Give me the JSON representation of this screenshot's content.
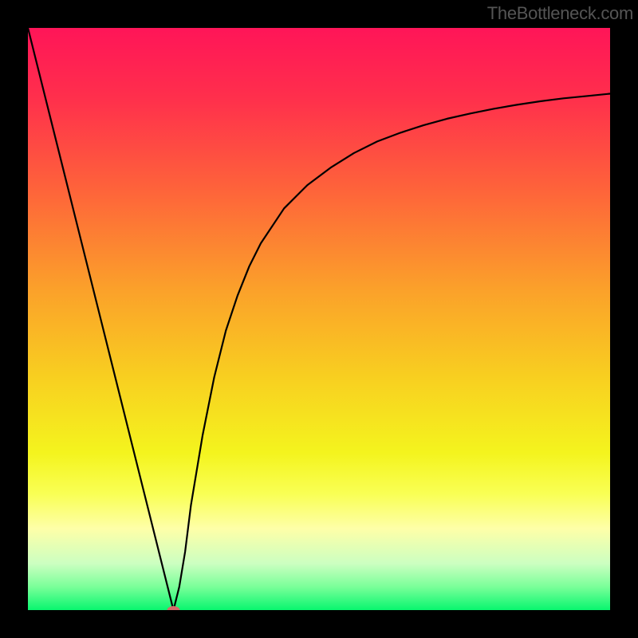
{
  "watermark": "TheBottleneck.com",
  "chart_data": {
    "type": "line",
    "title": "",
    "xlabel": "",
    "ylabel": "",
    "xlim": [
      0,
      100
    ],
    "ylim": [
      0,
      100
    ],
    "background": {
      "kind": "vertical-gradient",
      "stops": [
        {
          "pos": 0.0,
          "color": "#ff1558"
        },
        {
          "pos": 0.12,
          "color": "#ff2f4c"
        },
        {
          "pos": 0.28,
          "color": "#fe643a"
        },
        {
          "pos": 0.45,
          "color": "#fba12a"
        },
        {
          "pos": 0.6,
          "color": "#f8cf20"
        },
        {
          "pos": 0.73,
          "color": "#f4f41e"
        },
        {
          "pos": 0.8,
          "color": "#f9ff54"
        },
        {
          "pos": 0.86,
          "color": "#feffa8"
        },
        {
          "pos": 0.92,
          "color": "#ccffc1"
        },
        {
          "pos": 0.96,
          "color": "#7aff99"
        },
        {
          "pos": 1.0,
          "color": "#08f66f"
        }
      ]
    },
    "series": [
      {
        "name": "bottleneck-curve",
        "color": "#000000",
        "x": [
          0,
          2,
          4,
          6,
          8,
          10,
          12,
          14,
          16,
          18,
          20,
          22,
          24,
          25,
          26,
          27,
          28,
          30,
          32,
          34,
          36,
          38,
          40,
          44,
          48,
          52,
          56,
          60,
          64,
          68,
          72,
          76,
          80,
          84,
          88,
          92,
          96,
          100
        ],
        "y": [
          100,
          92,
          84,
          76,
          68,
          60,
          52,
          44,
          36,
          28,
          20,
          12,
          4,
          0,
          4,
          10,
          18,
          30,
          40,
          48,
          54,
          59,
          63,
          69,
          73,
          76,
          78.5,
          80.5,
          82,
          83.3,
          84.4,
          85.3,
          86.1,
          86.8,
          87.4,
          87.9,
          88.3,
          88.7
        ]
      }
    ],
    "markers": [
      {
        "name": "min-marker",
        "x": 25,
        "y": 0,
        "color": "#d46a6a",
        "rx": 8,
        "ry": 5
      }
    ]
  }
}
